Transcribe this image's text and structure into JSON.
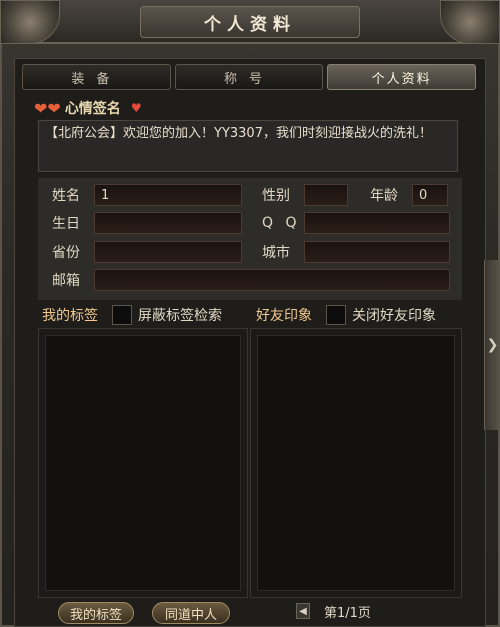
{
  "window": {
    "title": "个人资料"
  },
  "tabs": [
    {
      "label": "装备"
    },
    {
      "label": "称号"
    },
    {
      "label": "个人资料"
    }
  ],
  "mood": {
    "label": "心情签名",
    "text": "【北府公会】欢迎您的加入！YY3307，我们时刻迎接战火的洗礼！"
  },
  "profile": {
    "name_label": "姓名",
    "name_value": "1",
    "gender_label": "性别",
    "gender_value": "",
    "age_label": "年龄",
    "age_value": "0",
    "birthday_label": "生日",
    "birthday_value": "",
    "qq_label": "Q Q",
    "qq_value": "",
    "province_label": "省份",
    "province_value": "",
    "city_label": "城市",
    "city_value": "",
    "email_label": "邮箱",
    "email_value": ""
  },
  "tags": {
    "title": "我的标签",
    "checkbox_label": "屏蔽标签检索"
  },
  "friends": {
    "title": "好友印象",
    "checkbox_label": "关闭好友印象"
  },
  "buttons": {
    "my_tags": "我的标签",
    "like_minded": "同道中人"
  },
  "pager": {
    "prev_icon": "◀",
    "text": "第1/1页"
  },
  "side": {
    "arrow": "❯"
  }
}
